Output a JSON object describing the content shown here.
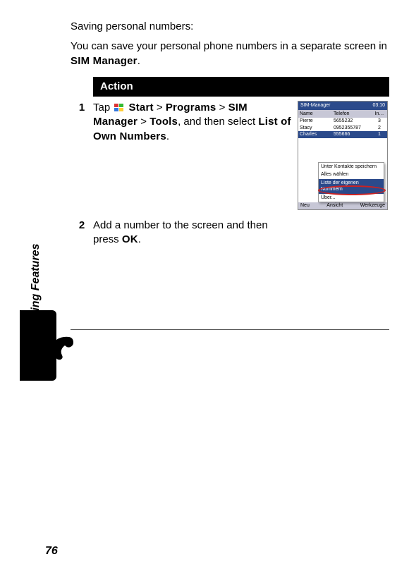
{
  "intro": {
    "heading": "Saving personal numbers:",
    "body_a": "You can save your personal phone numbers in a separate screen in ",
    "body_b": "SIM Manager",
    "body_c": "."
  },
  "table": {
    "header": "Action",
    "steps": [
      {
        "num": "1",
        "pre": "Tap ",
        "start": "Start",
        "sep1": " > ",
        "programs": "Programs",
        "sep2": " > ",
        "sim": "SIM Manager",
        "sep3": " > ",
        "tools": "Tools",
        "mid": ", and then select ",
        "list": "List of Own Numbers",
        "end": "."
      },
      {
        "num": "2",
        "pre": "Add a number to the screen and then press ",
        "ok": "OK",
        "end": "."
      }
    ]
  },
  "mock": {
    "title": "SIM-Manager",
    "time": "03:10",
    "col_name": "Name",
    "col_phone": "Telefon",
    "col_idx": "In…",
    "rows": [
      {
        "name": "Pierre",
        "phone": "5655232",
        "idx": "3"
      },
      {
        "name": "Stacy",
        "phone": "0952355787",
        "idx": "2"
      },
      {
        "name": "Charles",
        "phone": "555666",
        "idx": "1"
      }
    ],
    "menu": [
      "Unter Kontakte speichern",
      "Alles wählen",
      "Liste der eigenen Nummern",
      "Über..."
    ],
    "soft_left": "Neu",
    "soft_mid": "Ansicht",
    "soft_right": "Werkzeuge"
  },
  "side_label": "Calling Features",
  "page_number": "76"
}
